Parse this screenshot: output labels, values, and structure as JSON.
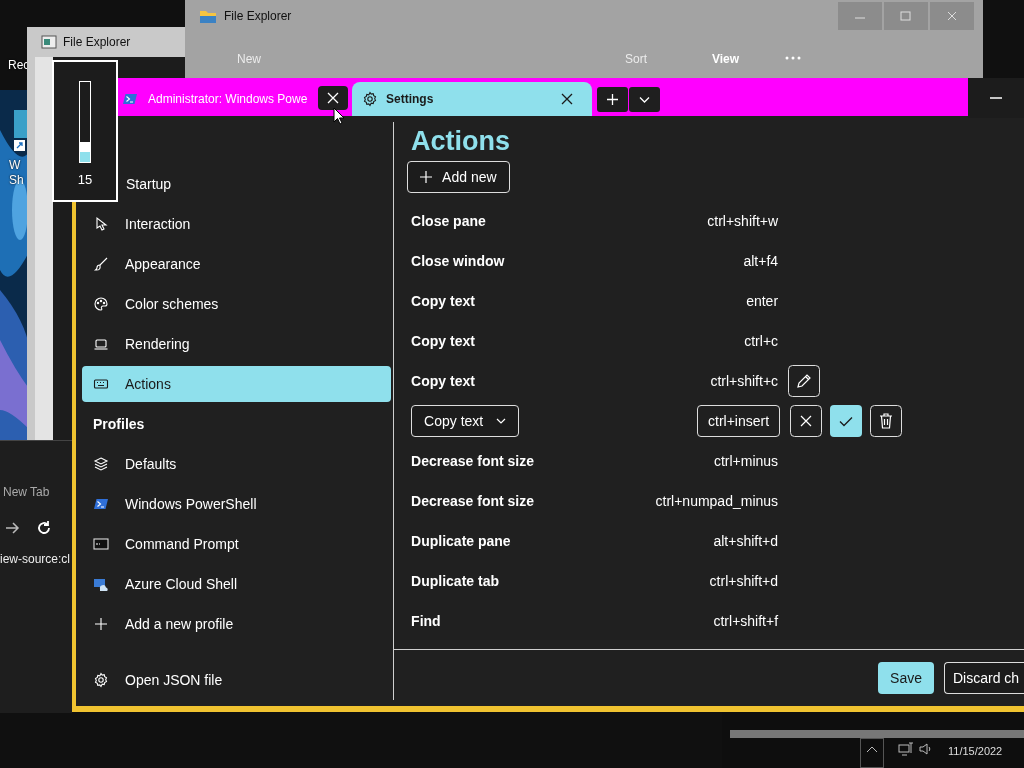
{
  "desktop": {
    "icons": [
      {
        "label_lines": [
          "Rec"
        ]
      },
      {
        "label_lines": [
          "W",
          "Sh"
        ]
      }
    ]
  },
  "file_explorer_back": {
    "title": "File Explorer"
  },
  "file_explorer_front": {
    "title": "File Explorer",
    "toolbar": [
      {
        "label": "New",
        "disabled": true
      },
      {
        "label": "Sort",
        "disabled": true
      },
      {
        "label": "View",
        "disabled": false
      }
    ]
  },
  "browser": {
    "tab": "New Tab",
    "address": "iew-source:cl"
  },
  "terminal": {
    "tabs": [
      {
        "title": "Administrator: Windows Powe",
        "selected": false
      },
      {
        "title": "Settings",
        "selected": true
      }
    ],
    "sidebar": {
      "items": [
        {
          "label": "Startup",
          "selected": false
        },
        {
          "label": "Interaction",
          "selected": false
        },
        {
          "label": "Appearance",
          "selected": false
        },
        {
          "label": "Color schemes",
          "selected": false
        },
        {
          "label": "Rendering",
          "selected": false
        },
        {
          "label": "Actions",
          "selected": true
        }
      ],
      "profiles_header": "Profiles",
      "profiles": [
        {
          "label": "Defaults",
          "selected": false
        },
        {
          "label": "Windows PowerShell",
          "selected": false
        },
        {
          "label": "Command Prompt",
          "selected": false
        },
        {
          "label": "Azure Cloud Shell",
          "selected": false
        },
        {
          "label": "Add a new profile",
          "selected": false
        }
      ],
      "footer_item": "Open JSON file"
    },
    "page": {
      "title": "Actions",
      "add_button": "Add new",
      "rows": [
        {
          "kind": "plain",
          "command": "Close pane",
          "keys": "ctrl+shift+w"
        },
        {
          "kind": "plain",
          "command": "Close window",
          "keys": "alt+f4"
        },
        {
          "kind": "plain",
          "command": "Copy text",
          "keys": "enter"
        },
        {
          "kind": "plain",
          "command": "Copy text",
          "keys": "ctrl+c"
        },
        {
          "kind": "hover",
          "command": "Copy text",
          "keys": "ctrl+shift+c"
        },
        {
          "kind": "edit",
          "command": "Copy text",
          "keys": "ctrl+insert"
        },
        {
          "kind": "plain",
          "command": "Decrease font size",
          "keys": "ctrl+minus"
        },
        {
          "kind": "plain",
          "command": "Decrease font size",
          "keys": "ctrl+numpad_minus"
        },
        {
          "kind": "plain",
          "command": "Duplicate pane",
          "keys": "alt+shift+d"
        },
        {
          "kind": "plain",
          "command": "Duplicate tab",
          "keys": "ctrl+shift+d"
        },
        {
          "kind": "plain",
          "command": "Find",
          "keys": "ctrl+shift+f"
        }
      ]
    },
    "buttons": [
      {
        "label": "Save",
        "kind": "primary"
      },
      {
        "label": "Discard ch",
        "kind": "secondary"
      }
    ]
  },
  "volume": {
    "level": 0.15,
    "reading": "15"
  },
  "taskbar": {
    "date": "11/15/2022"
  }
}
